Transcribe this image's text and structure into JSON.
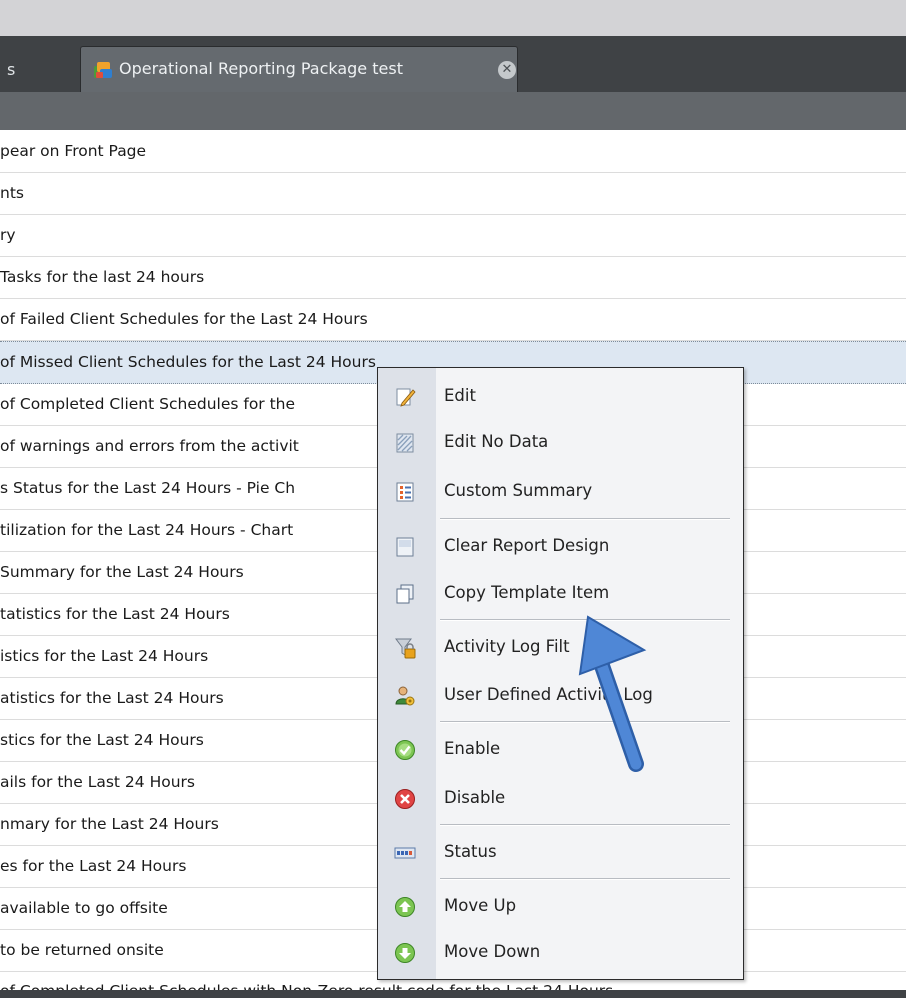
{
  "tabs": {
    "previous_tab_fragment": "s",
    "active_tab_title": "Operational Reporting Package test",
    "close_glyph": "✕"
  },
  "list_rows": [
    "pear on Front Page",
    "nts",
    "ry",
    "Tasks for the last 24 hours",
    "of Failed Client Schedules for the Last 24 Hours",
    "of Missed Client Schedules for the Last 24 Hours",
    "of Completed Client Schedules for the",
    "of warnings and errors from the activit",
    "s Status for the Last 24 Hours - Pie Ch",
    "tilization for the Last 24 Hours - Chart",
    "Summary for the Last 24 Hours",
    "tatistics for the Last 24 Hours",
    "istics for the Last 24 Hours",
    "atistics for the Last 24 Hours",
    "stics for the Last 24 Hours",
    "ails for the Last 24 Hours",
    "nmary for the Last 24 Hours",
    "es for the Last 24 Hours",
    " available to go offsite",
    " to be returned onsite",
    "of Completed Client Schedules with Non-Zero result code for the Last 24 Hours"
  ],
  "selected_row_index": 5,
  "context_menu": {
    "items": [
      {
        "label": "Edit",
        "icon": "pencil-icon"
      },
      {
        "label": "Edit No Data",
        "icon": "hatched-page-icon"
      },
      {
        "label": "Custom Summary",
        "icon": "list-page-icon"
      },
      {
        "label": "Clear Report Design",
        "icon": "blank-page-icon"
      },
      {
        "label": "Copy Template Item",
        "icon": "copy-icon"
      },
      {
        "label": "Activity Log Filt",
        "icon": "filter-lock-icon"
      },
      {
        "label": "User Defined Activity Log",
        "icon": "user-gear-icon"
      },
      {
        "label": "Enable",
        "icon": "check-circle-icon"
      },
      {
        "label": "Disable",
        "icon": "x-circle-icon"
      },
      {
        "label": "Status",
        "icon": "status-bar-icon"
      },
      {
        "label": "Move Up",
        "icon": "arrow-up-circle-icon"
      },
      {
        "label": "Move Down",
        "icon": "arrow-down-circle-icon"
      }
    ]
  },
  "colors": {
    "tab_bar": "#3f4245",
    "active_tab": "#656a6f",
    "selection": "#dde7f2",
    "menu_bg": "#f3f4f6",
    "menu_gutter": "#dde1e8",
    "annotation_arrow": "#4a80cf"
  }
}
